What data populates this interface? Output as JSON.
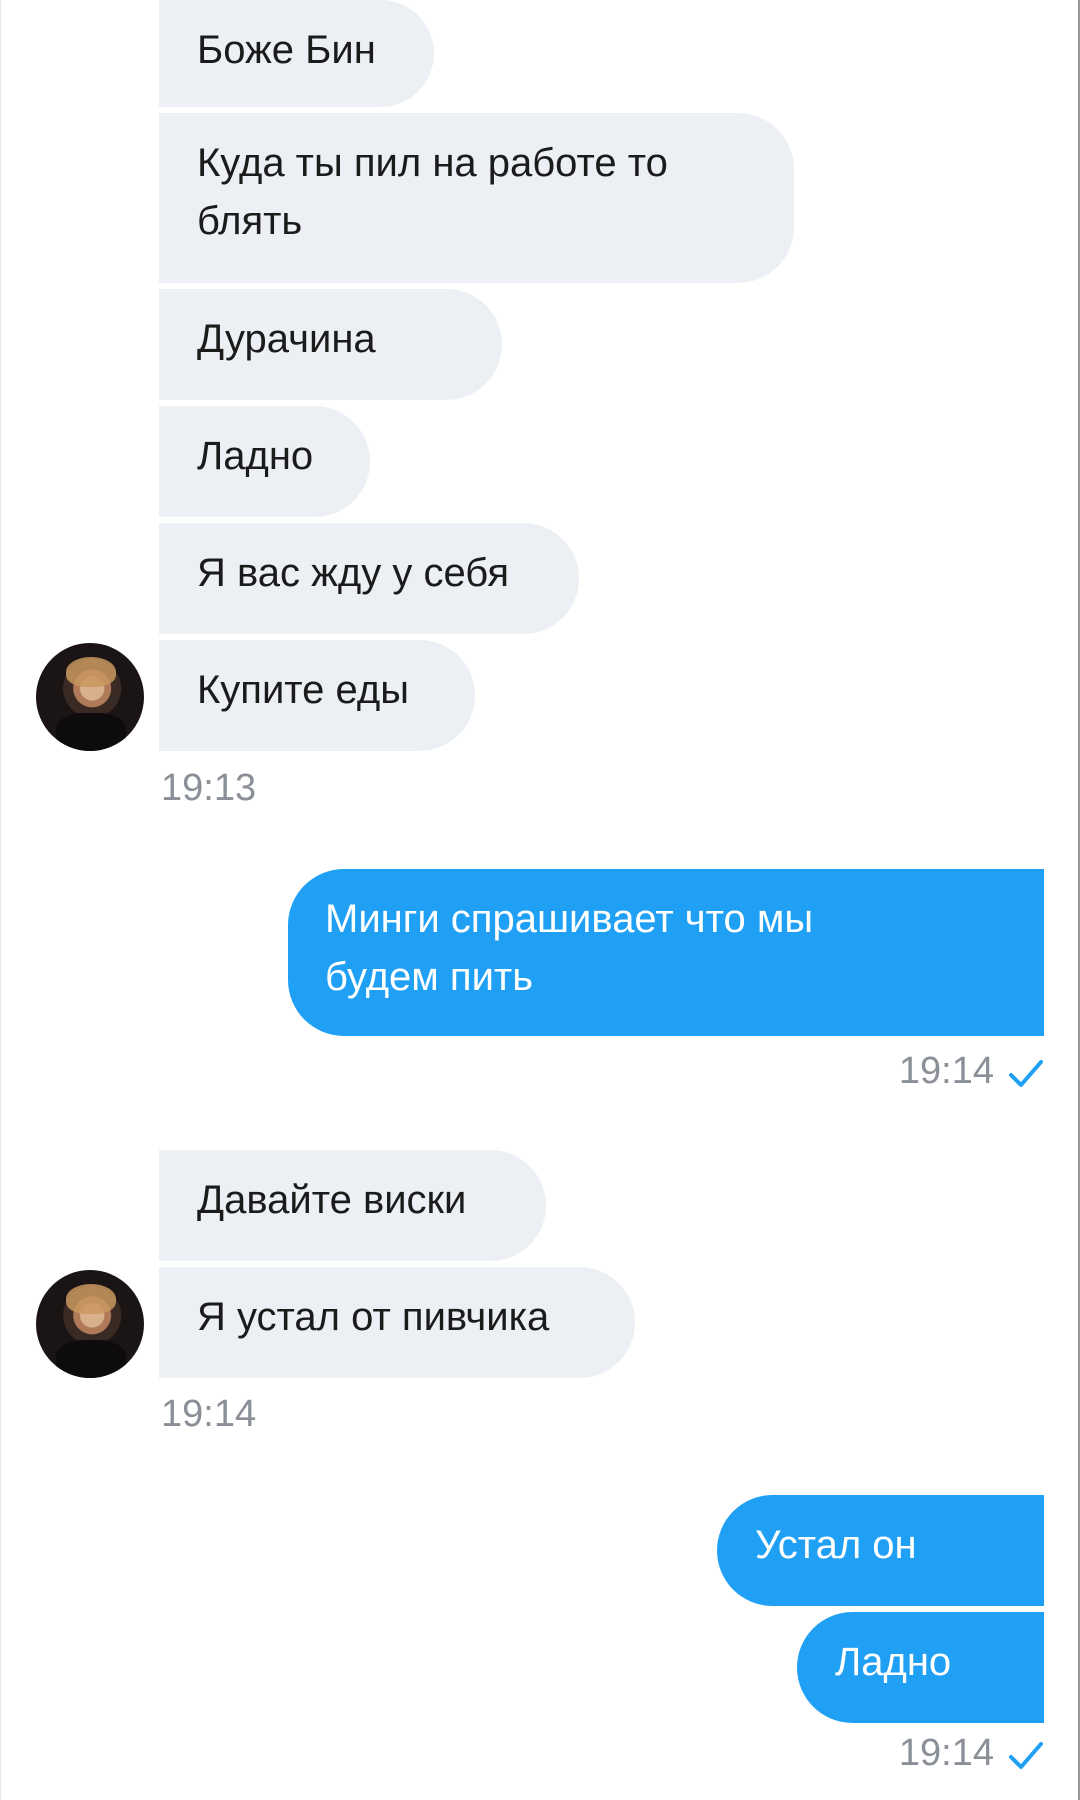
{
  "chat": {
    "group1": {
      "messages": [
        "Боже Бин",
        "Куда ты пил на работе то\nблять",
        "Дурачина",
        "Ладно",
        "Я вас жду у себя",
        "Купите еды"
      ],
      "time": "19:13"
    },
    "group2": {
      "messages": [
        "Минги спрашивает что мы\nбудем пить"
      ],
      "time": "19:14"
    },
    "group3": {
      "messages": [
        "Давайте виски",
        "Я устал от пивчика"
      ],
      "time": "19:14"
    },
    "group4": {
      "messages": [
        "Устал он",
        "Ладно"
      ],
      "time": "19:14"
    }
  },
  "icons": {
    "avatar": "avatar-photo",
    "read_status": "checkmark-icon"
  },
  "colors": {
    "incoming_bubble": "#eceff3",
    "outgoing_bubble": "#1fa0f5",
    "timestamp": "#8a8f98",
    "check": "#1fa0f5"
  }
}
